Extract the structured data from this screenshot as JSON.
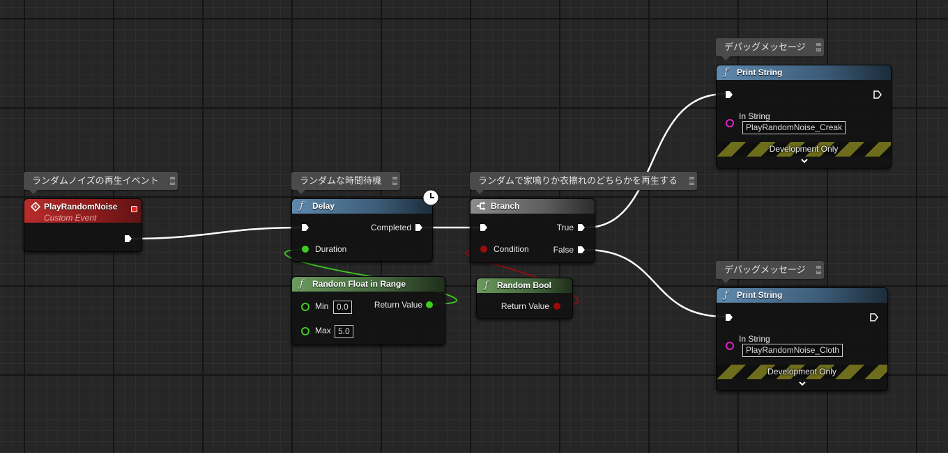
{
  "comments": {
    "event": "ランダムノイズの再生イベント",
    "delay": "ランダムな時間待機",
    "branch": "ランダムで家鳴りか衣擦れのどちらかを再生する",
    "debug_top": "デバッグメッセージ",
    "debug_bottom": "デバッグメッセージ"
  },
  "event_node": {
    "title": "PlayRandomNoise",
    "subtitle": "Custom Event"
  },
  "delay_node": {
    "title": "Delay",
    "completed_label": "Completed",
    "duration_label": "Duration"
  },
  "random_float_node": {
    "title": "Random Float in Range",
    "min_label": "Min",
    "min_value": "0.0",
    "max_label": "Max",
    "max_value": "5.0",
    "return_label": "Return Value"
  },
  "branch_node": {
    "title": "Branch",
    "true_label": "True",
    "false_label": "False",
    "condition_label": "Condition"
  },
  "random_bool_node": {
    "title": "Random Bool",
    "return_label": "Return Value"
  },
  "print_top": {
    "title": "Print String",
    "in_string_label": "In String",
    "in_string_value": "PlayRandomNoise_Creak",
    "dev_only": "Development Only"
  },
  "print_bottom": {
    "title": "Print String",
    "in_string_label": "In String",
    "in_string_value": "PlayRandomNoise_Cloth",
    "dev_only": "Development Only"
  },
  "colors": {
    "exec_wire": "#ffffff",
    "float_pin": "#3ecc20",
    "bool_pin": "#9b0c0c",
    "string_pin": "#e020c8",
    "function_header": "#3d5d79",
    "pure_header": "#44663c",
    "event_header": "#8d1b1b"
  },
  "icons": {
    "function": "f-icon",
    "branch": "branch-icon",
    "event": "event-diamond-icon",
    "latent": "clock-icon",
    "expand": "chevron-down-icon"
  }
}
